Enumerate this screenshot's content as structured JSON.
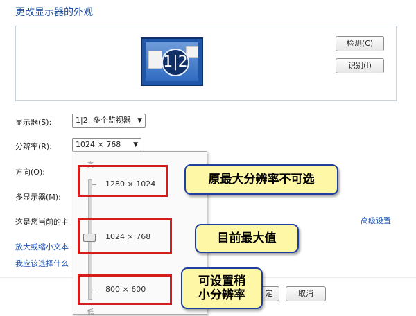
{
  "title": "更改显示器的外观",
  "buttons": {
    "detect": "检测(C)",
    "identify": "识别(I)",
    "ok": "定",
    "cancel": "取消"
  },
  "monitor_label": "1|2",
  "labels": {
    "display": "显示器(S):",
    "resolution": "分辨率(R):",
    "orientation": "方向(O):",
    "multi_display": "多显示器(M):",
    "current_settings": "这是您当前的主"
  },
  "display_value": "1|2. 多个监视器",
  "resolution_value": "1024 × 768",
  "resolution_slider": {
    "high_label": "高",
    "low_label": "低",
    "options": [
      "1280 × 1024",
      "1024 × 768",
      "800 × 600"
    ],
    "selected": "1024 × 768"
  },
  "callouts": {
    "max_not_selectable": "原最大分辨率不可选",
    "current_max": "目前最大值",
    "smaller_line1": "可设置稍",
    "smaller_line2": "小分辨率"
  },
  "links": {
    "advanced": "高级设置",
    "enlarge_text": "放大或缩小文本",
    "which_settings": "我应该选择什么"
  },
  "colors": {
    "title_blue": "#1f4f9b",
    "highlight_red": "#d41c1c",
    "callout_fill": "#fef7a6",
    "callout_border": "#1e3ea0",
    "link_blue": "#1f55b5"
  }
}
